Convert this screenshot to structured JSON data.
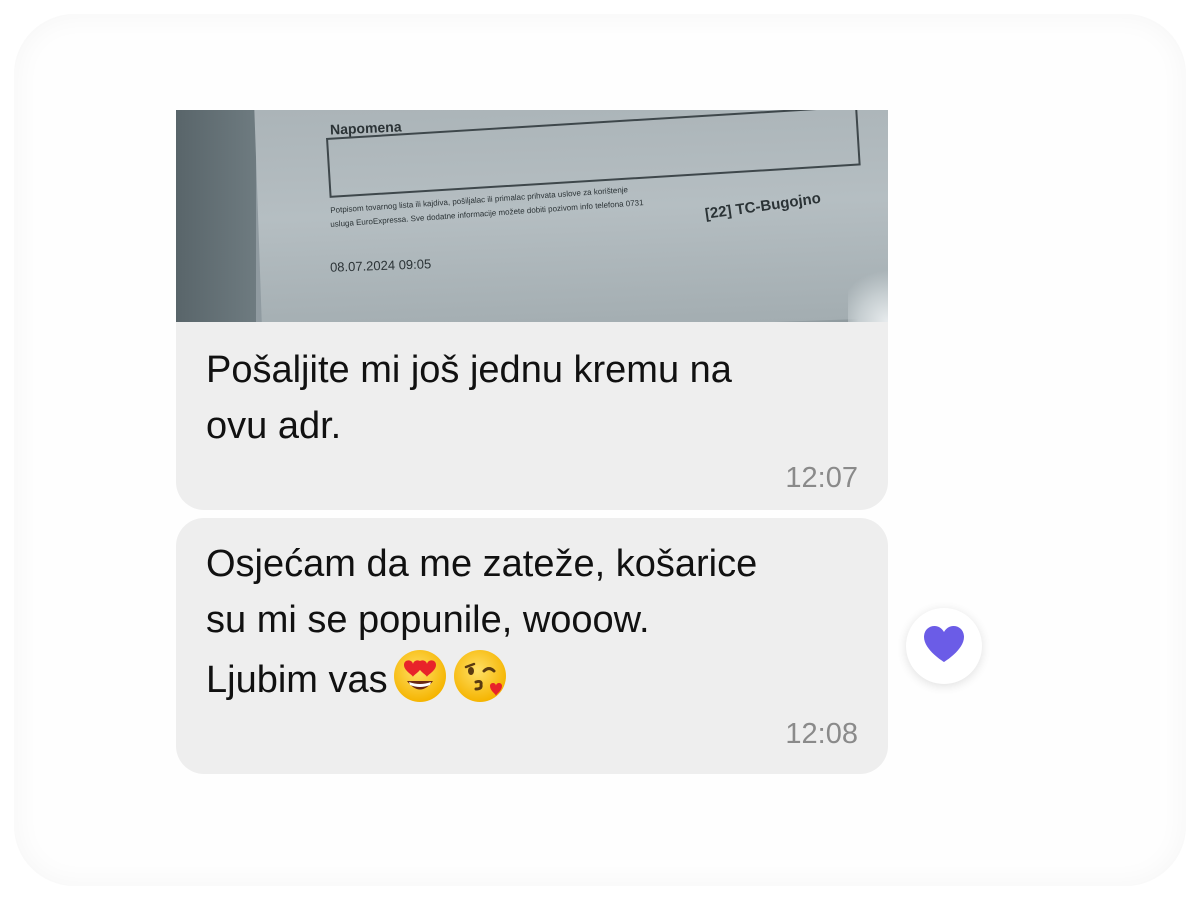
{
  "conversation": {
    "messages": [
      {
        "photo": {
          "label": "Napomena",
          "fine_print_1": "Potpisom tovarnog lista ili kajdiva, pošiljalac ili primalac prihvata uslove za korištenje",
          "fine_print_2": "usluga EuroExpressa. Sve dodatne informacije možete dobiti pozivom info telefona 0731",
          "office_code": "[22] TC-Bugojno",
          "date": "08.07.2024 09:05"
        },
        "text": "Pošaljite mi još jednu kremu na\novu adr.",
        "time": "12:07"
      },
      {
        "text": "Osjećam da me zateže, košarice\nsu mi se popunile, wooow.\nLjubim vas",
        "emojis": [
          "heart-eyes-emoji",
          "kissing-heart-emoji"
        ],
        "time": "12:08",
        "reaction": {
          "icon": "heart-icon",
          "color": "#6b5ce7"
        }
      }
    ],
    "colors": {
      "bubble": "#eeeeee",
      "text": "#111111",
      "timestamp": "#8a8a8a",
      "reaction": "#6b5ce7"
    }
  }
}
